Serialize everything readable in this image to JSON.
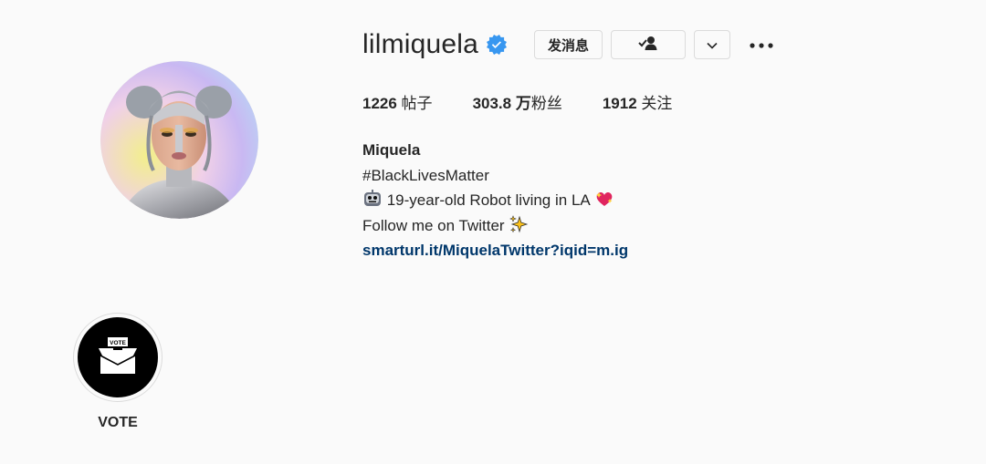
{
  "profile": {
    "username": "lilmiquela",
    "verified": true,
    "avatar_icon": "profile-photo"
  },
  "actions": {
    "message_label": "发消息",
    "following_icon": "person-check-icon",
    "suggest_icon": "chevron-down-icon",
    "more_icon": "ellipsis-icon"
  },
  "stats": {
    "posts_value": "1226",
    "posts_label": " 帖子",
    "followers_value": "303.8 万",
    "followers_label": "粉丝",
    "following_value": "1912",
    "following_label": " 关注"
  },
  "bio": {
    "name": "Miquela",
    "line1": "#BlackLivesMatter",
    "line2": " 19-year-old Robot living in LA ",
    "line2_icons": [
      "robot-face-icon",
      "sparkling-heart-icon"
    ],
    "line3": "Follow me on Twitter ",
    "line3_icon": "sparkles-icon",
    "link": "smarturl.it/MiquelaTwitter?iqid=m.ig"
  },
  "highlights": [
    {
      "label": "VOTE",
      "icon": "ballot-box-icon",
      "box_text": "VOTE"
    }
  ],
  "colors": {
    "background": "#fafafa",
    "text": "#262626",
    "link": "#00376b",
    "verified": "#3897f0",
    "border": "#dbdbdb"
  }
}
